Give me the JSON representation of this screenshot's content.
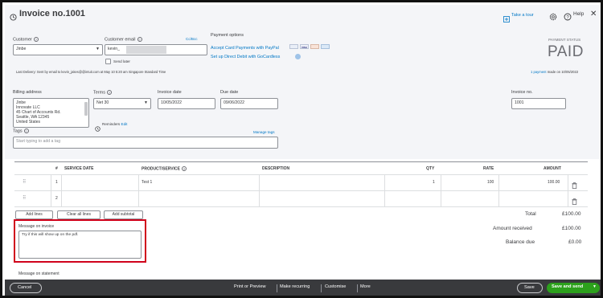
{
  "header": {
    "title": "Invoice no.1001",
    "take_tour": "Take a tour",
    "help": "Help"
  },
  "customer": {
    "label": "Customer",
    "value": "Jinbe",
    "email_label": "Customer email",
    "email_value": "kevin_",
    "cc_bcc": "Cc/Bcc",
    "send_later": "Send later",
    "last_delivery": "Last Delivery: Sent by email to kevin_jakes@@intuit.com at May 10 5:20 am Singapore Standard Time"
  },
  "payment_options": {
    "title": "Payment options",
    "paypal": "Accept Card Payments with PayPal",
    "gocardless": "Set up Direct Debit with GoCardless",
    "card_logos": [
      "PayPal",
      "VISA",
      "MC",
      "AMEX"
    ]
  },
  "status": {
    "label": "PAYMENT STATUS",
    "value": "PAID",
    "payment_link": "1 payment",
    "payment_made": "made on 10/05/2022"
  },
  "billing": {
    "label": "Billing address",
    "lines": [
      "Jinbe",
      "Innovate LLC",
      "45 Chart of Accounts Rd.",
      "Seattle, WA 12345",
      "United States"
    ]
  },
  "terms": {
    "label": "Terms",
    "value": "Net 30"
  },
  "invoice_date": {
    "label": "Invoice date",
    "value": "10/05/2022"
  },
  "due_date": {
    "label": "Due date",
    "value": "09/06/2022"
  },
  "invoice_no": {
    "label": "Invoice no.",
    "value": "1001"
  },
  "reminders": {
    "label": "Reminders",
    "edit": "Edit"
  },
  "tags": {
    "label": "Tags",
    "manage": "Manage tags",
    "placeholder": "Start typing to add a tag"
  },
  "table": {
    "headers": {
      "num": "#",
      "service_date": "SERVICE DATE",
      "product": "PRODUCT/SERVICE",
      "description": "DESCRIPTION",
      "qty": "QTY",
      "rate": "RATE",
      "amount": "AMOUNT"
    },
    "rows": [
      {
        "num": "1",
        "service_date": "",
        "product": "Test 1",
        "description": "",
        "qty": "1",
        "rate": "100",
        "amount": "100.00"
      },
      {
        "num": "2",
        "service_date": "",
        "product": "",
        "description": "",
        "qty": "",
        "rate": "",
        "amount": ""
      }
    ]
  },
  "actions": {
    "add_lines": "Add lines",
    "clear_all": "Clear all lines",
    "add_subtotal": "Add subtotal"
  },
  "message": {
    "label": "Message on invoice",
    "text": "Try if this will show up on the pdf.",
    "statement_label": "Message on statement"
  },
  "totals": {
    "total_label": "Total",
    "total_value": "£100.00",
    "received_label": "Amount received",
    "received_value": "£100.00",
    "balance_label": "Balance due",
    "balance_value": "£0.00"
  },
  "footer": {
    "cancel": "Cancel",
    "print": "Print or Preview",
    "recurring": "Make recurring",
    "customise": "Customise",
    "more": "More",
    "save": "Save",
    "save_send": "Save and send"
  },
  "colors": {
    "brand_green": "#2ca01c",
    "link_blue": "#0077c5",
    "footer_bg": "#393a3d",
    "highlight_red": "#d0021b"
  }
}
